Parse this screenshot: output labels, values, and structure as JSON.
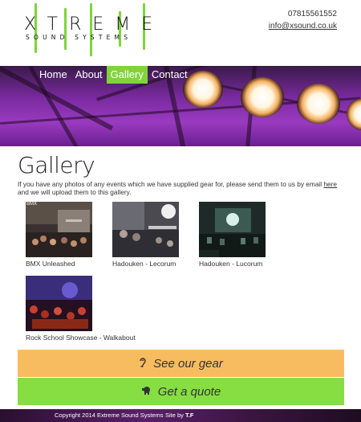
{
  "logo": {
    "word": "XTREME",
    "sub": "SOUND SYSTEMS"
  },
  "contact": {
    "phone": "07815561552",
    "email": "info@xsound.co.uk"
  },
  "nav": [
    {
      "label": "Home",
      "active": false
    },
    {
      "label": "About",
      "active": false
    },
    {
      "label": "Gallery",
      "active": true
    },
    {
      "label": "Contact",
      "active": false
    }
  ],
  "page": {
    "title": "Gallery",
    "intro_before": "If you have any photos of any events which we have supplied gear for, please send them to us by email ",
    "intro_link": "here",
    "intro_after": " and we will upload them to this gallery."
  },
  "gallery": [
    {
      "caption": "BMX Unleashed",
      "overlay": "BMX"
    },
    {
      "caption": "Hadouken - Lecorum"
    },
    {
      "caption": "Hadouken - Lucorum"
    },
    {
      "caption": "Rock School Showcase - Walkabout"
    }
  ],
  "cta": {
    "gear_label": "See our gear",
    "gear_icon": "ear-icon",
    "quote_label": "Get a quote",
    "quote_icon": "piggy-bank-icon"
  },
  "footer": {
    "copyright": "Copyright 2014 Extreme Sound Systems",
    "site_by_prefix": "Site by ",
    "site_by_initials": "T.F"
  },
  "colors": {
    "accent_green": "#7fd43a",
    "gear_orange": "#f8bc60",
    "quote_green": "#86de42",
    "banner_purple": "#7a2aa0"
  }
}
